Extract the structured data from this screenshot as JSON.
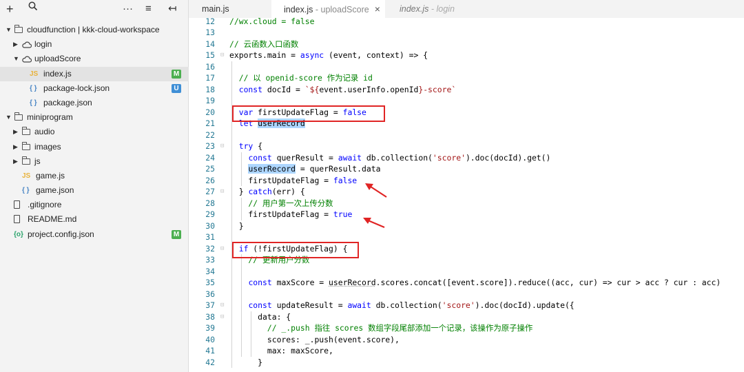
{
  "sidebar": {
    "toolbar": {
      "add": "+",
      "search_icon": "search-icon",
      "more": "···",
      "sort": "≡",
      "collapse": "↤"
    },
    "tree": [
      {
        "label": "cloudfunction | kkk-cloud-workspace",
        "icon": "cloud-folder-icon",
        "depth": 0,
        "arrow": "▼"
      },
      {
        "label": "login",
        "icon": "cloud-icon",
        "depth": 1,
        "arrow": "▶"
      },
      {
        "label": "uploadScore",
        "icon": "cloud-icon",
        "depth": 1,
        "arrow": "▼"
      },
      {
        "label": "index.js",
        "icon": "js-file-icon",
        "depth": 2,
        "badge": "M",
        "selected": true
      },
      {
        "label": "package-lock.json",
        "icon": "json-file-icon",
        "depth": 2,
        "badge": "U"
      },
      {
        "label": "package.json",
        "icon": "json-file-icon",
        "depth": 2
      },
      {
        "label": "miniprogram",
        "icon": "folder-open-icon",
        "depth": 0,
        "arrow": "▼"
      },
      {
        "label": "audio",
        "icon": "folder-icon",
        "depth": 1,
        "arrow": "▶"
      },
      {
        "label": "images",
        "icon": "folder-icon",
        "depth": 1,
        "arrow": "▶"
      },
      {
        "label": "js",
        "icon": "folder-icon",
        "depth": 1,
        "arrow": "▶"
      },
      {
        "label": "game.js",
        "icon": "js-file-icon",
        "depth": 1
      },
      {
        "label": "game.json",
        "icon": "json-file-icon",
        "depth": 1
      },
      {
        "label": ".gitignore",
        "icon": "file-icon",
        "depth": 0
      },
      {
        "label": "README.md",
        "icon": "file-icon",
        "depth": 0
      },
      {
        "label": "project.config.json",
        "icon": "config-file-icon",
        "depth": 0,
        "badge": "M"
      }
    ]
  },
  "tabs": [
    {
      "label": "main.js",
      "sub": "",
      "state": "normal"
    },
    {
      "label": "index.js",
      "sub": " - uploadScore",
      "state": "active",
      "close": "×"
    },
    {
      "label": "index.js",
      "sub": " - login",
      "state": "preview"
    }
  ],
  "editor": {
    "colors": {
      "comment": "#008000",
      "keyword": "#0000ff",
      "string": "#a31515",
      "line_number": "#237893",
      "highlight_box": "#e02424"
    },
    "lines": [
      {
        "n": "12",
        "t": [
          [
            "//wx.cloud = false",
            "com"
          ]
        ]
      },
      {
        "n": "13",
        "t": []
      },
      {
        "n": "14",
        "t": [
          [
            "// 云函数入口函数",
            "com"
          ]
        ]
      },
      {
        "n": "15",
        "fold": true,
        "t": [
          [
            "exports.main = ",
            ""
          ],
          [
            "async",
            "kw"
          ],
          [
            " (event, context) => {",
            ""
          ]
        ]
      },
      {
        "n": "16",
        "t": []
      },
      {
        "n": "17",
        "t": [
          [
            "  // 以 openid-score 作为记录 id",
            "com"
          ]
        ]
      },
      {
        "n": "18",
        "t": [
          [
            "  ",
            ""
          ],
          [
            "const",
            "kw"
          ],
          [
            " docId = ",
            ""
          ],
          [
            "`${",
            "str"
          ],
          [
            "event.userInfo.openId",
            ""
          ],
          [
            "}-score`",
            "str"
          ]
        ]
      },
      {
        "n": "19",
        "t": []
      },
      {
        "n": "20",
        "t": [
          [
            "  ",
            ""
          ],
          [
            "var",
            "kw"
          ],
          [
            " firstUpdateFlag = ",
            ""
          ],
          [
            "false",
            "kw"
          ]
        ]
      },
      {
        "n": "21",
        "t": [
          [
            "  ",
            ""
          ],
          [
            "let",
            "kw"
          ],
          [
            " ",
            ""
          ],
          [
            "userRecord",
            "hl"
          ]
        ]
      },
      {
        "n": "22",
        "t": []
      },
      {
        "n": "23",
        "fold": true,
        "t": [
          [
            "  ",
            ""
          ],
          [
            "try",
            "kw"
          ],
          [
            " {",
            ""
          ]
        ]
      },
      {
        "n": "24",
        "t": [
          [
            "    ",
            ""
          ],
          [
            "const",
            "kw"
          ],
          [
            " querResult = ",
            ""
          ],
          [
            "await",
            "kw"
          ],
          [
            " db.collection(",
            ""
          ],
          [
            "'score'",
            "str"
          ],
          [
            ").doc(docId).get()",
            ""
          ]
        ]
      },
      {
        "n": "25",
        "t": [
          [
            "    ",
            ""
          ],
          [
            "userRecord",
            "hl"
          ],
          [
            " = querResult.data",
            ""
          ]
        ]
      },
      {
        "n": "26",
        "t": [
          [
            "    firstUpdateFlag = ",
            ""
          ],
          [
            "false",
            "kw"
          ]
        ]
      },
      {
        "n": "27",
        "fold": true,
        "t": [
          [
            "  } ",
            ""
          ],
          [
            "catch",
            "kw"
          ],
          [
            "(err) {",
            ""
          ]
        ]
      },
      {
        "n": "28",
        "t": [
          [
            "    // 用户第一次上传分数",
            "com"
          ]
        ]
      },
      {
        "n": "29",
        "t": [
          [
            "    firstUpdateFlag = ",
            ""
          ],
          [
            "true",
            "kw"
          ]
        ]
      },
      {
        "n": "30",
        "t": [
          [
            "  }",
            ""
          ]
        ]
      },
      {
        "n": "31",
        "t": []
      },
      {
        "n": "32",
        "fold": true,
        "t": [
          [
            "  ",
            ""
          ],
          [
            "if",
            "kw"
          ],
          [
            " (!firstUpdateFlag) {",
            ""
          ]
        ]
      },
      {
        "n": "33",
        "t": [
          [
            "    // 更新用户分数",
            "com"
          ]
        ]
      },
      {
        "n": "34",
        "t": []
      },
      {
        "n": "35",
        "t": [
          [
            "    ",
            ""
          ],
          [
            "const",
            "kw"
          ],
          [
            " maxScore = ",
            ""
          ],
          [
            "userRecord",
            "uline"
          ],
          [
            ".scores.concat([event.score]).reduce((acc, cur) => cur > acc ? cur : acc)",
            ""
          ]
        ]
      },
      {
        "n": "36",
        "t": []
      },
      {
        "n": "37",
        "fold": true,
        "t": [
          [
            "    ",
            ""
          ],
          [
            "const",
            "kw"
          ],
          [
            " updateResult = ",
            ""
          ],
          [
            "await",
            "kw"
          ],
          [
            " db.collection(",
            ""
          ],
          [
            "'score'",
            "str"
          ],
          [
            ").doc(docId).update({",
            ""
          ]
        ]
      },
      {
        "n": "38",
        "fold": true,
        "t": [
          [
            "      data: {",
            ""
          ]
        ]
      },
      {
        "n": "39",
        "t": [
          [
            "        // _.push 指往 scores 数组字段尾部添加一个记录，该操作为原子操作",
            "com"
          ]
        ]
      },
      {
        "n": "40",
        "t": [
          [
            "        scores: _.push(event.score),",
            ""
          ]
        ]
      },
      {
        "n": "41",
        "t": [
          [
            "        max: maxScore,",
            ""
          ]
        ]
      },
      {
        "n": "42",
        "t": [
          [
            "      }",
            ""
          ]
        ]
      }
    ]
  }
}
